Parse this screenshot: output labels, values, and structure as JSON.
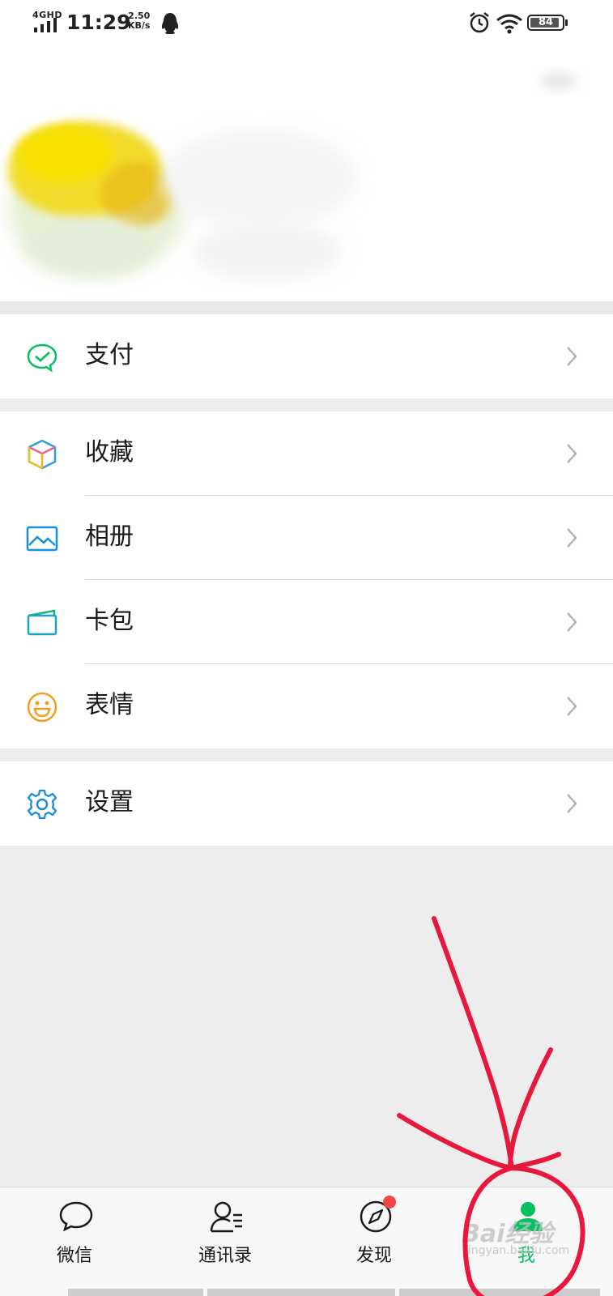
{
  "status_bar": {
    "network": "4GHD",
    "time": "11:29",
    "speed_value": "2.50",
    "speed_unit": "KB/s",
    "battery_percent": "84",
    "icons": [
      "signal-icon",
      "qq-icon",
      "alarm-icon",
      "wifi-icon",
      "battery-icon"
    ]
  },
  "menu": {
    "groups": [
      {
        "items": [
          {
            "label": "支付",
            "icon": "pay-icon",
            "icon_color": "#07c160"
          }
        ]
      },
      {
        "items": [
          {
            "label": "收藏",
            "icon": "favorites-icon",
            "icon_color": "#f0a020"
          },
          {
            "label": "相册",
            "icon": "album-icon",
            "icon_color": "#1a8fdc"
          },
          {
            "label": "卡包",
            "icon": "card-wallet-icon",
            "icon_color": "#1aa3c9"
          },
          {
            "label": "表情",
            "icon": "sticker-icon",
            "icon_color": "#f0a020"
          }
        ]
      },
      {
        "items": [
          {
            "label": "设置",
            "icon": "settings-icon",
            "icon_color": "#1a8fdc"
          }
        ]
      }
    ]
  },
  "tabbar": {
    "tabs": [
      {
        "label": "微信",
        "icon": "chat-icon",
        "active": false
      },
      {
        "label": "通讯录",
        "icon": "contacts-icon",
        "active": false
      },
      {
        "label": "发现",
        "icon": "discover-icon",
        "active": false,
        "badge": true
      },
      {
        "label": "我",
        "icon": "me-icon",
        "active": true
      }
    ],
    "active_color": "#07c160",
    "badge_color": "#f04848"
  },
  "annotation": {
    "color": "#e8173c",
    "shape": "hand-drawn arrow and circle around the 我 tab"
  },
  "watermark": {
    "text": "Bai经验",
    "sub": "jingyan.baidu.com"
  }
}
